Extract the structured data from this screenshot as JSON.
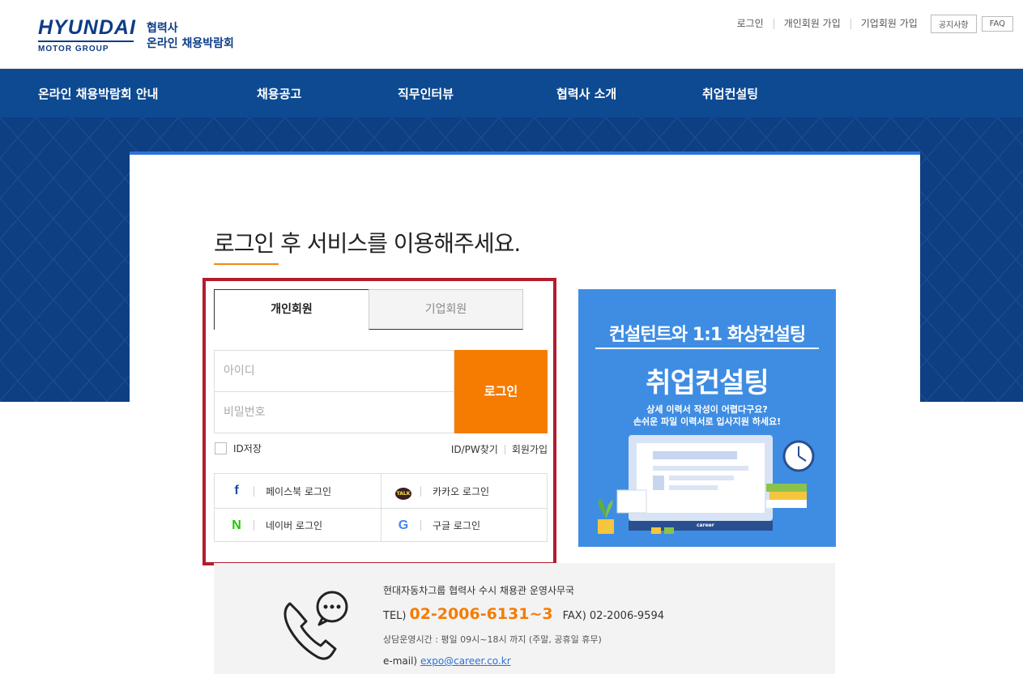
{
  "header": {
    "logo_brand": "HYUNDAI",
    "logo_sub": "MOTOR GROUP",
    "logo_title_line1": "협력사",
    "logo_title_line2": "온라인 채용박람회",
    "util_links": [
      "로그인",
      "개인회원 가입",
      "기업회원 가입"
    ],
    "util_buttons": [
      "공지사항",
      "FAQ"
    ]
  },
  "nav": {
    "items": [
      "온라인 채용박람회 안내",
      "채용공고",
      "직무인터뷰",
      "협력사 소개",
      "취업컨설팅"
    ]
  },
  "login": {
    "title": "로그인 후 서비스를 이용해주세요.",
    "tabs": [
      "개인회원",
      "기업회원"
    ],
    "id_placeholder": "아이디",
    "pw_placeholder": "비밀번호",
    "login_button": "로그인",
    "save_id_label": "ID저장",
    "find_label": "ID/PW찾기",
    "join_label": "회원가입",
    "social": {
      "facebook": "페이스북 로그인",
      "kakao": "카카오 로그인",
      "naver": "네이버 로그인",
      "google": "구글 로그인",
      "kakao_badge": "TALK"
    }
  },
  "banner": {
    "headline": "컨설턴트와 1:1 화상컨설팅",
    "main": "취업컨설팅",
    "desc_line1": "상세 이력서 작성이 어렵다구요?",
    "desc_line2": "손쉬운 파일 이력서로 입사지원 하세요!",
    "screen_label": "career"
  },
  "contact": {
    "org": "현대자동차그룹 협력사 수시 채용관 운영사무국",
    "tel_prefix": "TEL)",
    "tel_number": "02-2006-6131~3",
    "fax": "FAX) 02-2006-9594",
    "hours": "상담운영시간 : 평일 09시~18시 까지 (주말, 공휴일 휴무)",
    "email_prefix": "e-mail)",
    "email": "expo@career.co.kr"
  },
  "colors": {
    "brand_blue": "#0d4a91",
    "accent_orange": "#f57c00",
    "highlight_red": "#b21d2e",
    "banner_blue": "#3f8de3"
  }
}
